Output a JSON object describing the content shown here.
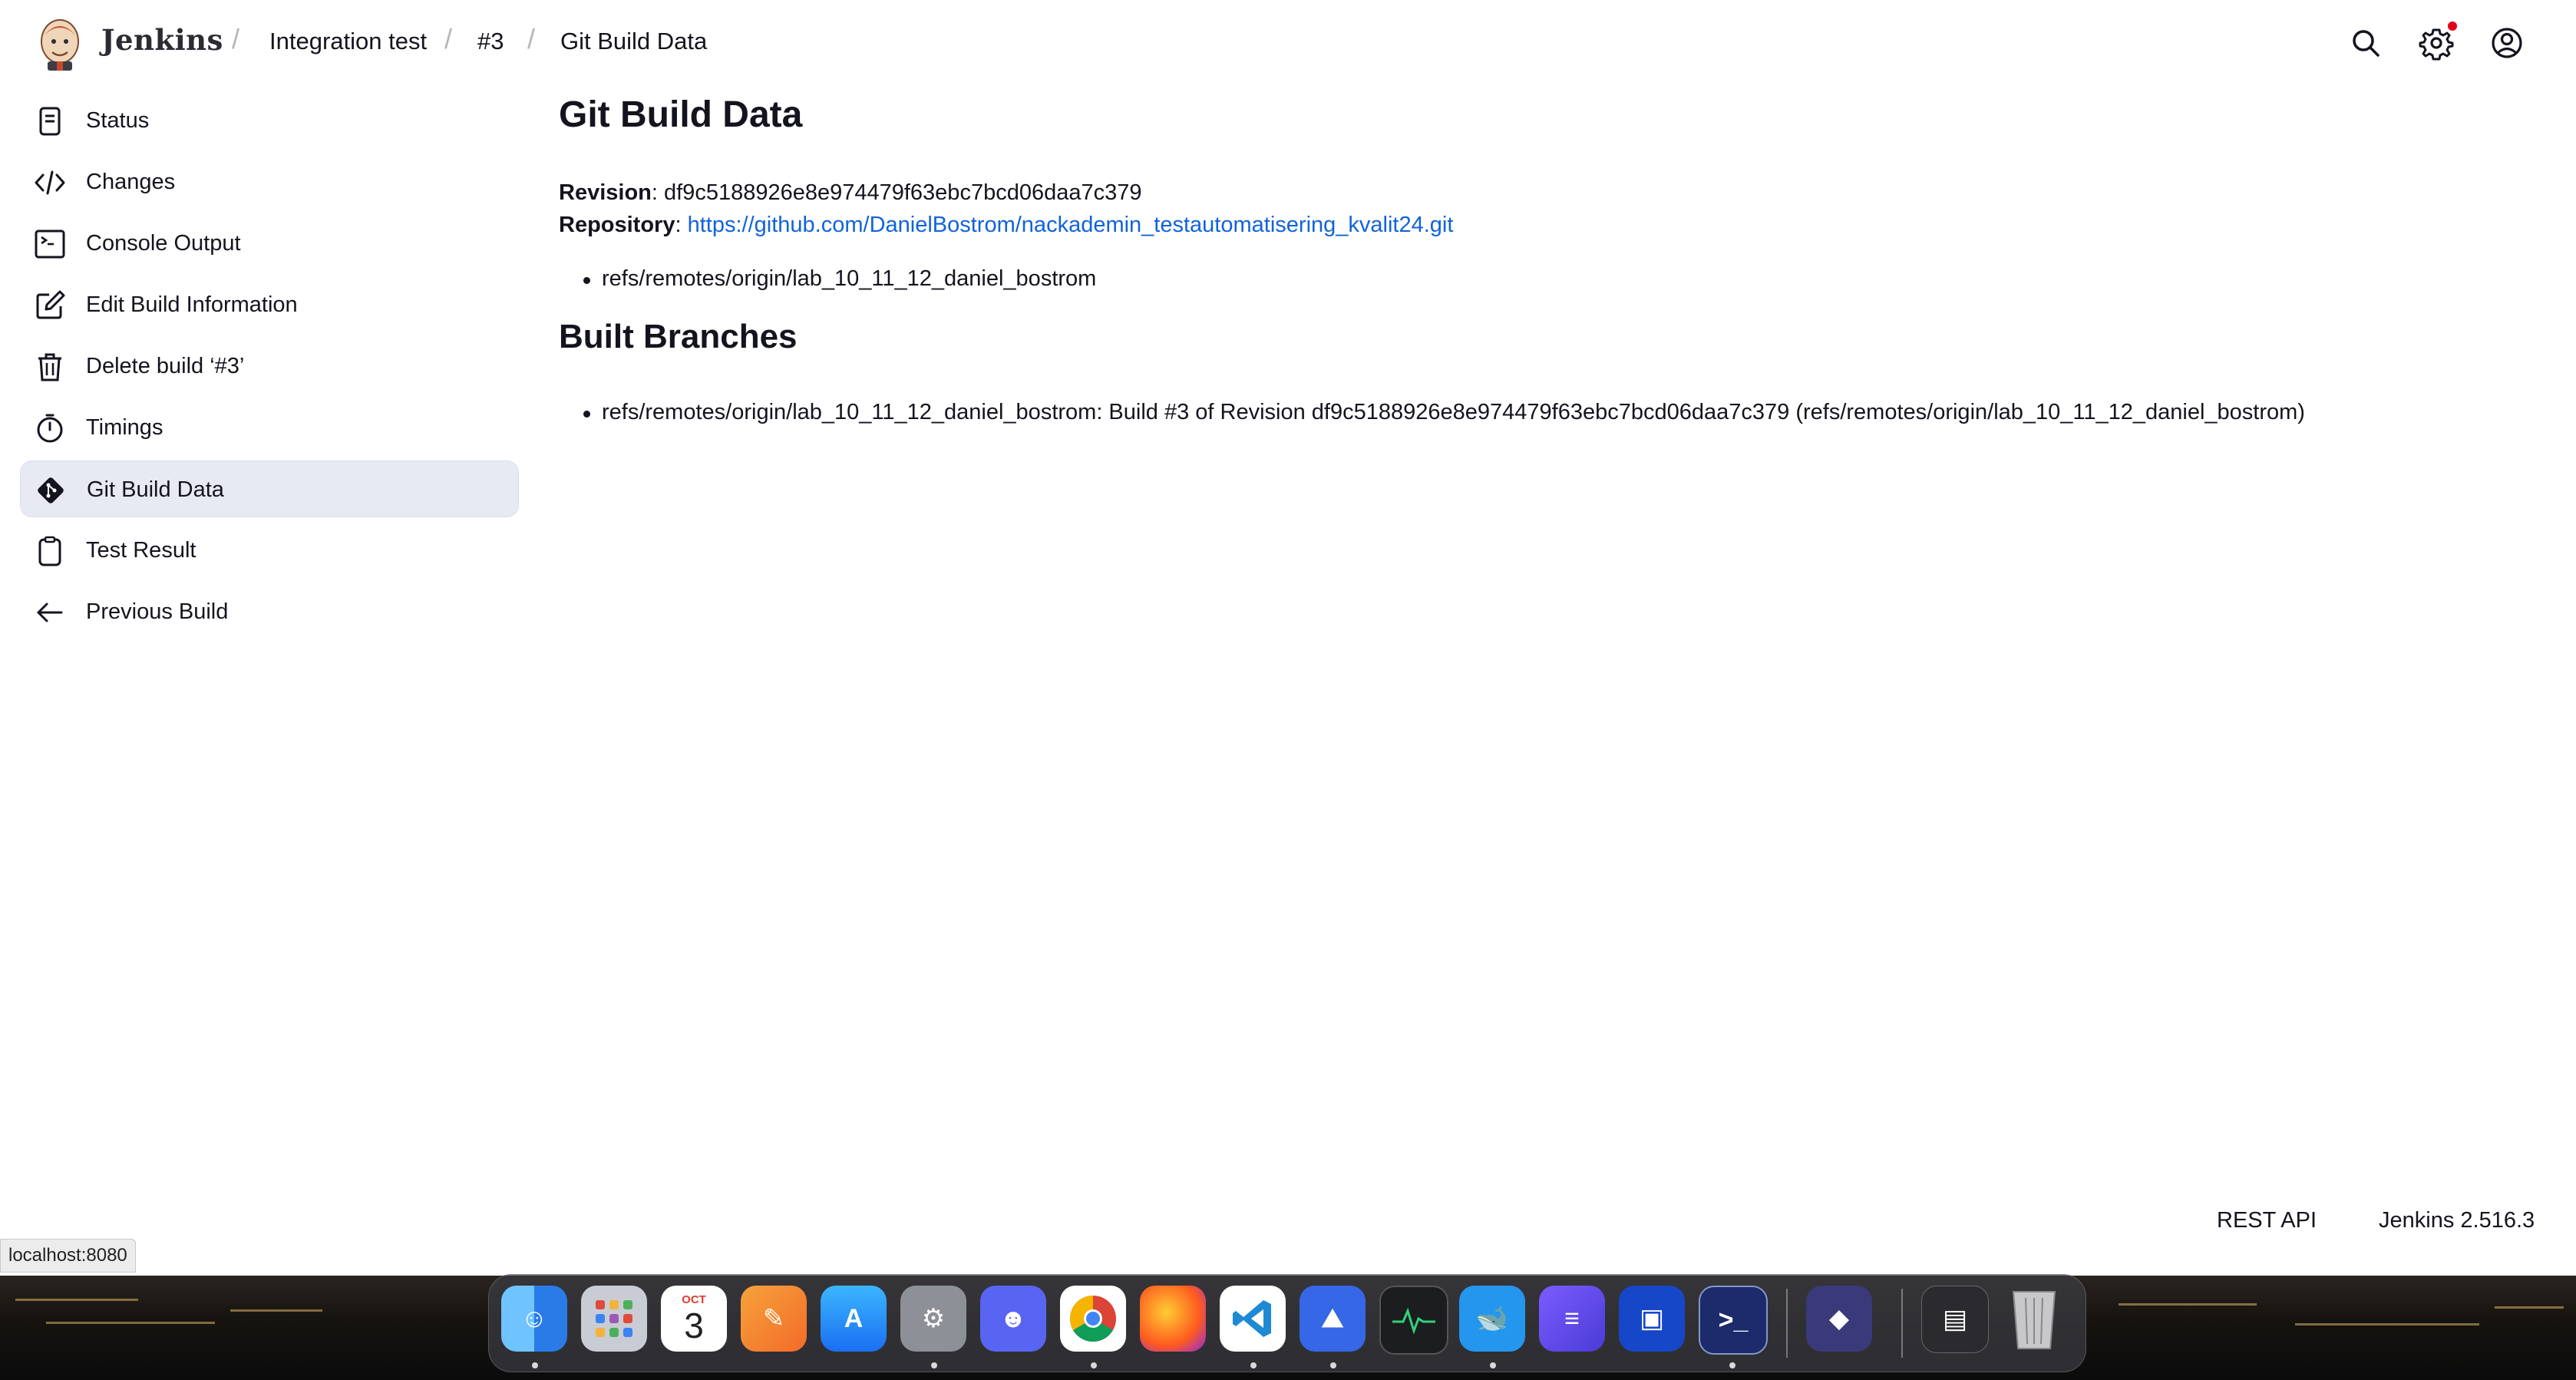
{
  "header": {
    "brand": "Jenkins",
    "breadcrumbs": [
      "Integration test",
      "#3",
      "Git Build Data"
    ],
    "separator": "/",
    "icons": [
      "search-icon",
      "gear-icon",
      "user-icon"
    ],
    "notification_color": "#e6001f"
  },
  "sidebar": {
    "items": [
      {
        "label": "Status",
        "icon": "document-icon",
        "active": false
      },
      {
        "label": "Changes",
        "icon": "code-icon",
        "active": false
      },
      {
        "label": "Console Output",
        "icon": "terminal-icon",
        "active": false
      },
      {
        "label": "Edit Build Information",
        "icon": "edit-icon",
        "active": false
      },
      {
        "label": "Delete build ‘#3’",
        "icon": "trash-icon",
        "active": false
      },
      {
        "label": "Timings",
        "icon": "stopwatch-icon",
        "active": false
      },
      {
        "label": "Git Build Data",
        "icon": "git-icon",
        "active": true
      },
      {
        "label": "Test Result",
        "icon": "clipboard-icon",
        "active": false
      },
      {
        "label": "Previous Build",
        "icon": "arrow-left-icon",
        "active": false
      }
    ]
  },
  "main": {
    "title": "Git Build Data",
    "revision_label": "Revision",
    "revision_value": "df9c5188926e8e974479f63ebc7bcd06daa7c379",
    "repository_label": "Repository",
    "repository_url": "https://github.com/DanielBostrom/nackademin_testautomatisering_kvalit24.git",
    "refs": [
      "refs/remotes/origin/lab_10_11_12_daniel_bostrom"
    ],
    "built_branches_title": "Built Branches",
    "built_branches": [
      "refs/remotes/origin/lab_10_11_12_daniel_bostrom: Build #3 of Revision df9c5188926e8e974479f63ebc7bcd06daa7c379 (refs/remotes/origin/lab_10_11_12_daniel_bostrom)"
    ]
  },
  "footer": {
    "rest_api": "REST API",
    "version": "Jenkins 2.516.3"
  },
  "status_url": "localhost:8080",
  "dock": {
    "apps": [
      "finder-icon",
      "launchpad-icon",
      "calendar-icon",
      "pages-icon",
      "app-store-icon",
      "system-settings-icon",
      "discord-icon",
      "chrome-icon",
      "firefox-icon",
      "vscode-icon",
      "nordvpn-icon",
      "activity-monitor-icon",
      "docker-icon",
      "linear-icon",
      "mirror-icon",
      "terminal-app-icon",
      "proton-icon",
      "preview-icon",
      "trash-app-icon"
    ],
    "calendar_month": "OCT",
    "calendar_day": "3"
  },
  "colors": {
    "link": "#1163d9",
    "active_item_bg": "#e8eaf3"
  }
}
